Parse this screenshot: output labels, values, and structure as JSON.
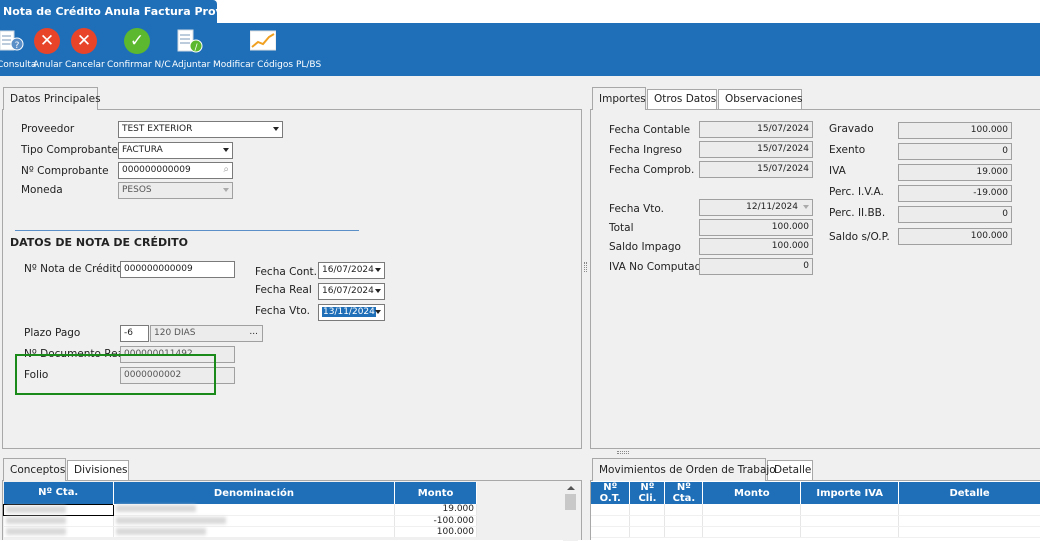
{
  "window": {
    "title": "Nota de Crédito Anula Factura Proveedor"
  },
  "colors": {
    "accent": "#1f6fb8",
    "highlight": "#1a8a1a"
  },
  "toolbar": {
    "buttons": [
      {
        "label": "Consulta",
        "icon": "document-search-icon"
      },
      {
        "label": "Anular",
        "icon": "cancel-red-icon"
      },
      {
        "label": "Cancelar",
        "icon": "cancel-red-icon"
      },
      {
        "label": "Confirmar N/C",
        "icon": "check-green-icon"
      },
      {
        "label": "Adjuntar",
        "icon": "document-attach-icon"
      },
      {
        "label": "Modificar Códigos PL/BS",
        "icon": "chart-line-icon"
      }
    ]
  },
  "left_panel": {
    "tab": "Datos Principales",
    "proveedor": {
      "label": "Proveedor",
      "value": "TEST EXTERIOR"
    },
    "tipo_comprobante": {
      "label": "Tipo Comprobante",
      "value": "FACTURA"
    },
    "nro_comprobante": {
      "label": "Nº Comprobante",
      "value": "000000000009"
    },
    "moneda": {
      "label": "Moneda",
      "value": "PESOS"
    },
    "section_title": "DATOS DE NOTA DE CRÉDITO",
    "nro_nota": {
      "label": "Nº Nota de Crédito",
      "value": "000000000009"
    },
    "fecha_cont": {
      "label": "Fecha Cont.",
      "value": "16/07/2024"
    },
    "fecha_real": {
      "label": "Fecha Real",
      "value": "16/07/2024"
    },
    "fecha_vto": {
      "label": "Fecha Vto.",
      "value": "13/11/2024"
    },
    "plazo_pago": {
      "label": "Plazo Pago",
      "value": "-6",
      "desc": "120 DIAS",
      "button": "..."
    },
    "nro_doc_real": {
      "label": "Nº Documento Real",
      "value": "000000011492"
    },
    "folio": {
      "label": "Folio",
      "value": "0000000002"
    }
  },
  "right_panel": {
    "tabs": [
      "Importes",
      "Otros Datos",
      "Observaciones"
    ],
    "fecha_contable": {
      "label": "Fecha Contable",
      "value": "15/07/2024"
    },
    "fecha_ingreso": {
      "label": "Fecha Ingreso",
      "value": "15/07/2024"
    },
    "fecha_comprob": {
      "label": "Fecha Comprob.",
      "value": "15/07/2024"
    },
    "fecha_vto": {
      "label": "Fecha Vto.",
      "value": "12/11/2024"
    },
    "total": {
      "label": "Total",
      "value": "100.000"
    },
    "saldo_impago": {
      "label": "Saldo Impago",
      "value": "100.000"
    },
    "iva_no_computado": {
      "label": "IVA No Computado",
      "value": "0"
    },
    "gravado": {
      "label": "Gravado",
      "value": "100.000"
    },
    "exento": {
      "label": "Exento",
      "value": "0"
    },
    "iva": {
      "label": "IVA",
      "value": "19.000"
    },
    "perc_iva": {
      "label": "Perc. I.V.A.",
      "value": "-19.000"
    },
    "perc_iibb": {
      "label": "Perc. II.BB.",
      "value": "0"
    },
    "saldo_op": {
      "label": "Saldo s/O.P.",
      "value": "100.000"
    }
  },
  "bottom_left": {
    "tabs": [
      "Conceptos",
      "Divisiones"
    ],
    "columns": [
      "Nº Cta.",
      "Denominación",
      "Monto"
    ],
    "rows": [
      {
        "monto": "19.000"
      },
      {
        "monto": "-100.000"
      },
      {
        "monto": "100.000"
      }
    ]
  },
  "bottom_right": {
    "tabs": [
      "Movimientos de Orden de Trabajo",
      "Detalle"
    ],
    "columns": [
      "Nº O.T.",
      "Nº Cli.",
      "Nº Cta.",
      "Monto",
      "Importe IVA",
      "Detalle"
    ]
  }
}
